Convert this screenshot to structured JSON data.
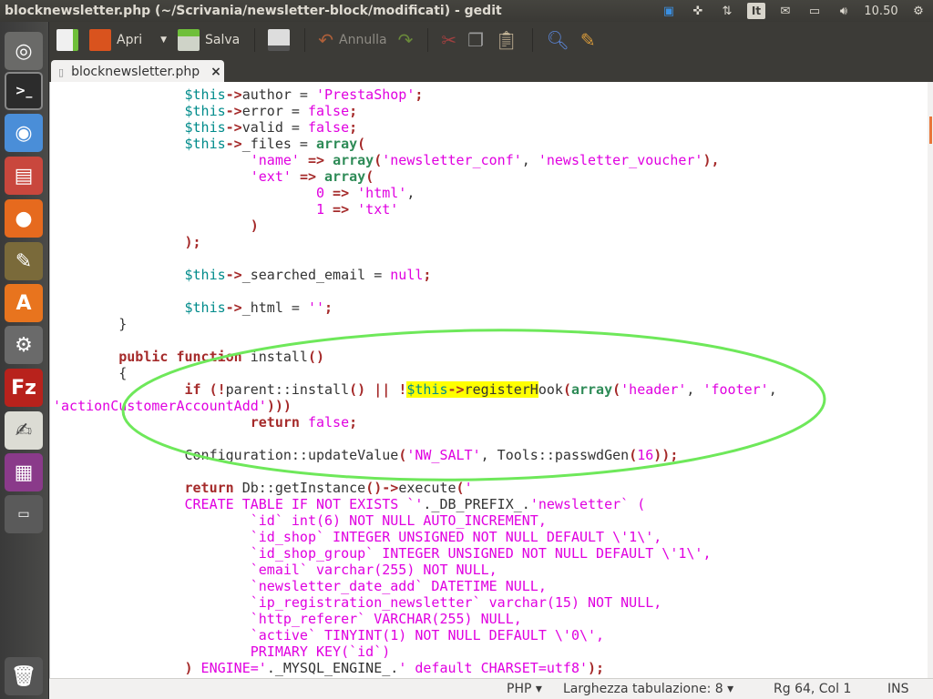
{
  "window": {
    "title": "blocknewsletter.php (~/Scrivania/newsletter-block/modificati) - gedit"
  },
  "tray": {
    "keyboard": "It",
    "clock": "10.50"
  },
  "launcher": [
    "ubuntu-dash",
    "terminal",
    "chromium",
    "files",
    "firefox",
    "gimp",
    "software-center",
    "settings",
    "filezilla",
    "gedit",
    "workspaces",
    "libreoffice-impress",
    "trash"
  ],
  "toolbar": {
    "open": "Apri",
    "save": "Salva",
    "undo": "Annulla"
  },
  "tab": {
    "label": "blocknewsletter.php",
    "close": "×"
  },
  "code": [
    [
      [
        "p",
        "\t\t"
      ],
      [
        "v",
        "$this"
      ],
      [
        "o",
        "->"
      ],
      [
        "p",
        "author = "
      ],
      [
        "s",
        "'PrestaShop'"
      ],
      [
        "o",
        ";"
      ]
    ],
    [
      [
        "p",
        "\t\t"
      ],
      [
        "v",
        "$this"
      ],
      [
        "o",
        "->"
      ],
      [
        "p",
        "error = "
      ],
      [
        "b",
        "false"
      ],
      [
        "o",
        ";"
      ]
    ],
    [
      [
        "p",
        "\t\t"
      ],
      [
        "v",
        "$this"
      ],
      [
        "o",
        "->"
      ],
      [
        "p",
        "valid = "
      ],
      [
        "b",
        "false"
      ],
      [
        "o",
        ";"
      ]
    ],
    [
      [
        "p",
        "\t\t"
      ],
      [
        "v",
        "$this"
      ],
      [
        "o",
        "->"
      ],
      [
        "p",
        "_files = "
      ],
      [
        "f",
        "array"
      ],
      [
        "o",
        "("
      ]
    ],
    [
      [
        "p",
        "\t\t\t"
      ],
      [
        "s",
        "'name'"
      ],
      [
        "p",
        " "
      ],
      [
        "o",
        "=>"
      ],
      [
        "p",
        " "
      ],
      [
        "f",
        "array"
      ],
      [
        "o",
        "("
      ],
      [
        "s",
        "'newsletter_conf'"
      ],
      [
        "p",
        ", "
      ],
      [
        "s",
        "'newsletter_voucher'"
      ],
      [
        "o",
        "),"
      ]
    ],
    [
      [
        "p",
        "\t\t\t"
      ],
      [
        "s",
        "'ext'"
      ],
      [
        "p",
        " "
      ],
      [
        "o",
        "=>"
      ],
      [
        "p",
        " "
      ],
      [
        "f",
        "array"
      ],
      [
        "o",
        "("
      ]
    ],
    [
      [
        "p",
        "\t\t\t\t"
      ],
      [
        "b",
        "0"
      ],
      [
        "p",
        " "
      ],
      [
        "o",
        "=>"
      ],
      [
        "p",
        " "
      ],
      [
        "s",
        "'html'"
      ],
      [
        "p",
        ","
      ]
    ],
    [
      [
        "p",
        "\t\t\t\t"
      ],
      [
        "b",
        "1"
      ],
      [
        "p",
        " "
      ],
      [
        "o",
        "=>"
      ],
      [
        "p",
        " "
      ],
      [
        "s",
        "'txt'"
      ]
    ],
    [
      [
        "p",
        "\t\t\t"
      ],
      [
        "o",
        ")"
      ]
    ],
    [
      [
        "p",
        "\t\t"
      ],
      [
        "o",
        ");"
      ]
    ],
    [],
    [
      [
        "p",
        "\t\t"
      ],
      [
        "v",
        "$this"
      ],
      [
        "o",
        "->"
      ],
      [
        "p",
        "_searched_email = "
      ],
      [
        "b",
        "null"
      ],
      [
        "o",
        ";"
      ]
    ],
    [],
    [
      [
        "p",
        "\t\t"
      ],
      [
        "v",
        "$this"
      ],
      [
        "o",
        "->"
      ],
      [
        "p",
        "_html = "
      ],
      [
        "s",
        "''"
      ],
      [
        "o",
        ";"
      ]
    ],
    [
      [
        "p",
        "\t}"
      ]
    ],
    [],
    [
      [
        "p",
        "\t"
      ],
      [
        "k",
        "public function"
      ],
      [
        "p",
        " install"
      ],
      [
        "o",
        "()"
      ]
    ],
    [
      [
        "p",
        "\t{"
      ]
    ],
    [
      [
        "p",
        "\t\t"
      ],
      [
        "k",
        "if"
      ],
      [
        "p",
        " "
      ],
      [
        "o",
        "(!"
      ],
      [
        "p",
        "parent::install"
      ],
      [
        "o",
        "()"
      ],
      [
        "p",
        " "
      ],
      [
        "o",
        "||"
      ],
      [
        "p",
        " "
      ],
      [
        "o",
        "!"
      ],
      [
        "v h",
        "$this"
      ],
      [
        "o h",
        "->"
      ],
      [
        "p h",
        "registerH"
      ],
      [
        "p",
        "ook"
      ],
      [
        "o",
        "("
      ],
      [
        "f",
        "array"
      ],
      [
        "o",
        "("
      ],
      [
        "s",
        "'header'"
      ],
      [
        "p",
        ", "
      ],
      [
        "s",
        "'footer'"
      ],
      [
        "p",
        ","
      ]
    ],
    [
      [
        "s",
        "'actionCustomerAccountAdd'"
      ],
      [
        "o",
        ")))"
      ]
    ],
    [
      [
        "p",
        "\t\t\t"
      ],
      [
        "k",
        "return"
      ],
      [
        "p",
        " "
      ],
      [
        "b",
        "false"
      ],
      [
        "o",
        ";"
      ]
    ],
    [],
    [
      [
        "p",
        "\t\tConfiguration::updateValue"
      ],
      [
        "o",
        "("
      ],
      [
        "s",
        "'NW_SALT'"
      ],
      [
        "p",
        ", Tools::passwdGen"
      ],
      [
        "o",
        "("
      ],
      [
        "b",
        "16"
      ],
      [
        "o",
        "));"
      ]
    ],
    [],
    [
      [
        "p",
        "\t\t"
      ],
      [
        "k",
        "return"
      ],
      [
        "p",
        " Db::getInstance"
      ],
      [
        "o",
        "()->"
      ],
      [
        "p",
        "execute"
      ],
      [
        "o",
        "("
      ],
      [
        "s",
        "'"
      ]
    ],
    [
      [
        "s",
        "\t\tCREATE TABLE IF NOT EXISTS `'"
      ],
      [
        "p",
        "._DB_PREFIX_."
      ],
      [
        "s",
        "'newsletter` ("
      ]
    ],
    [
      [
        "s",
        "\t\t\t`id` int(6) NOT NULL AUTO_INCREMENT,"
      ]
    ],
    [
      [
        "s",
        "\t\t\t`id_shop` INTEGER UNSIGNED NOT NULL DEFAULT \\'1\\',"
      ]
    ],
    [
      [
        "s",
        "\t\t\t`id_shop_group` INTEGER UNSIGNED NOT NULL DEFAULT \\'1\\',"
      ]
    ],
    [
      [
        "s",
        "\t\t\t`email` varchar(255) NOT NULL,"
      ]
    ],
    [
      [
        "s",
        "\t\t\t`newsletter_date_add` DATETIME NULL,"
      ]
    ],
    [
      [
        "s",
        "\t\t\t`ip_registration_newsletter` varchar(15) NOT NULL,"
      ]
    ],
    [
      [
        "s",
        "\t\t\t`http_referer` VARCHAR(255) NULL,"
      ]
    ],
    [
      [
        "s",
        "\t\t\t`active` TINYINT(1) NOT NULL DEFAULT \\'0\\',"
      ]
    ],
    [
      [
        "s",
        "\t\t\tPRIMARY KEY(`id`)"
      ]
    ],
    [
      [
        "p",
        "\t\t"
      ],
      [
        "o",
        ")"
      ],
      [
        "s",
        " ENGINE='"
      ],
      [
        "p",
        "._MYSQL_ENGINE_."
      ],
      [
        "s",
        "' default CHARSET=utf8'"
      ],
      [
        "o",
        ");"
      ]
    ]
  ],
  "statusbar": {
    "language": "PHP ▾",
    "tab_width": "Larghezza tabulazione: 8 ▾",
    "position": "Rg 64, Col 1",
    "mode": "INS"
  },
  "colors": {
    "annotation_ellipse": "#6ee85a",
    "highlight": "#ffff00"
  }
}
